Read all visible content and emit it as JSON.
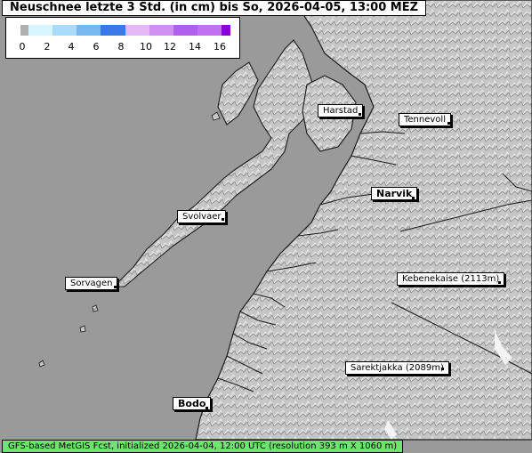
{
  "title": "Neuschnee letzte 3 Std. (in cm) bis So, 2026-04-05, 13:00 MEZ",
  "legend": {
    "ticks": [
      "0",
      "2",
      "4",
      "6",
      "8",
      "10",
      "12",
      "14",
      "16"
    ],
    "colors": [
      "#b0b0b0",
      "#d8f6ff",
      "#a8dcfa",
      "#78b8f0",
      "#3a78e8",
      "#e4b8f4",
      "#d090f0",
      "#b060ec",
      "#8a00d8"
    ]
  },
  "places": [
    {
      "name": "Harstad",
      "bold": false
    },
    {
      "name": "Tennevoll",
      "bold": false
    },
    {
      "name": "Narvik",
      "bold": true
    },
    {
      "name": "Svolvaer",
      "bold": false
    },
    {
      "name": "Sorvagen",
      "bold": false
    },
    {
      "name": "Kebenekaise (2113m)",
      "bold": false
    },
    {
      "name": "Sarektjakka (2089m)",
      "bold": false
    },
    {
      "name": "Bodo",
      "bold": true
    }
  ],
  "footer": "GFS-based MetGIS Fcst, initialized 2026-04-04, 12:00 UTC  (resolution 393 m X 1060 m)",
  "colors": {
    "sea": "#9a9a9a",
    "land": "#c8c8c8",
    "coast": "#1a1a1a",
    "footer": "#6ee36e"
  }
}
